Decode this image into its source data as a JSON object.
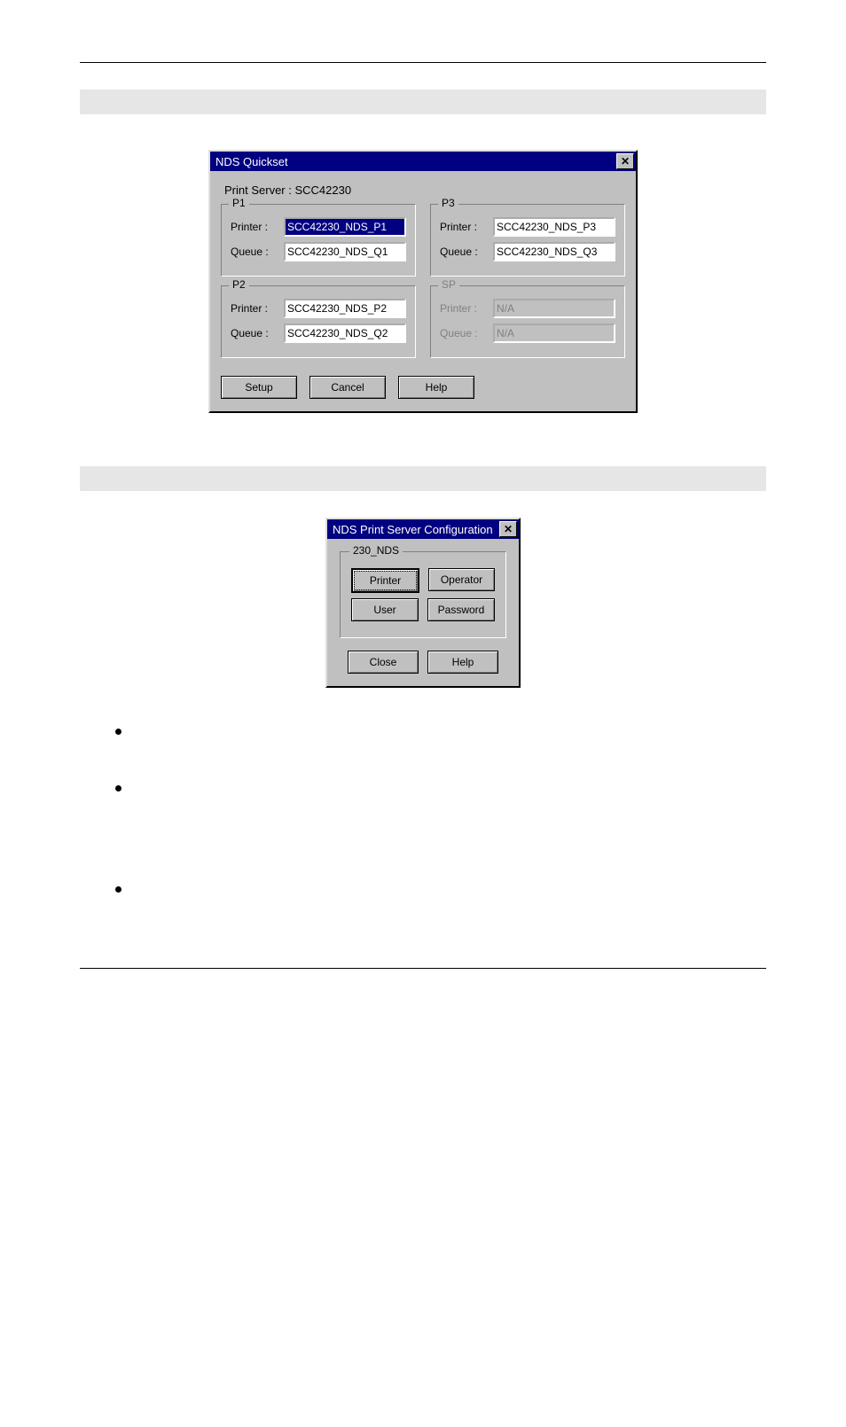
{
  "quickset": {
    "title": "NDS Quickset",
    "print_server_label": "Print Server : SCC42230",
    "groups": {
      "p1": {
        "title": "P1",
        "printer_label": "Printer :",
        "queue_label": "Queue :",
        "printer": "SCC42230_NDS_P1",
        "queue": "SCC42230_NDS_Q1"
      },
      "p2": {
        "title": "P2",
        "printer_label": "Printer :",
        "queue_label": "Queue :",
        "printer": "SCC42230_NDS_P2",
        "queue": "SCC42230_NDS_Q2"
      },
      "p3": {
        "title": "P3",
        "printer_label": "Printer :",
        "queue_label": "Queue :",
        "printer": "SCC42230_NDS_P3",
        "queue": "SCC42230_NDS_Q3"
      },
      "sp": {
        "title": "SP",
        "printer_label": "Printer :",
        "queue_label": "Queue :",
        "printer": "N/A",
        "queue": "N/A"
      }
    },
    "buttons": {
      "setup": "Setup",
      "cancel": "Cancel",
      "help": "Help"
    }
  },
  "psconfig": {
    "title": "NDS Print Server Configuration",
    "group_title": "230_NDS",
    "buttons": {
      "printer": "Printer",
      "operator": "Operator",
      "user": "User",
      "password": "Password",
      "close": "Close",
      "help": "Help"
    }
  },
  "close_glyph": "✕"
}
